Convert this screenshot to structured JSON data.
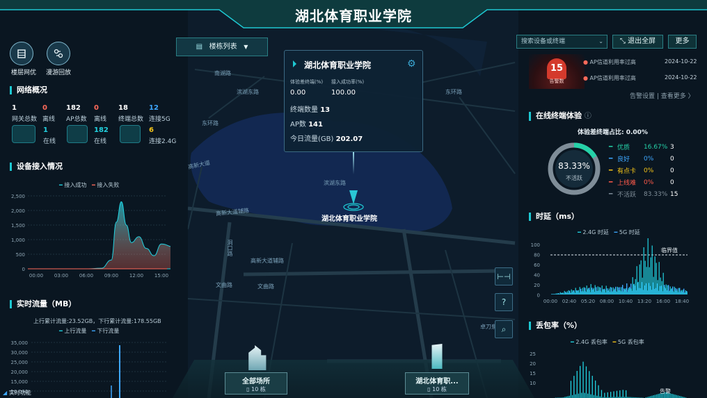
{
  "header": {
    "title": "湖北体育职业学院"
  },
  "left_tools": [
    {
      "label": "楼层网优",
      "icon": "building-floor-icon"
    },
    {
      "label": "漫游回放",
      "icon": "roaming-playback-icon"
    }
  ],
  "network": {
    "title": "网络概况",
    "row1": [
      {
        "value": "1",
        "label": "网关总数"
      },
      {
        "value": "0",
        "label": "离线"
      },
      {
        "value": "182",
        "label": "AP总数"
      },
      {
        "value": "0",
        "label": "离线"
      },
      {
        "value": "18",
        "label": "终端总数"
      },
      {
        "value": "12",
        "label": "连接5G"
      }
    ],
    "row2": [
      {
        "value": "1",
        "label": "在线"
      },
      {
        "value": "182",
        "label": "在线"
      },
      {
        "value": "6",
        "label": "连接2.4G"
      }
    ]
  },
  "access": {
    "title": "设备接入情况",
    "legend": [
      "接入成功",
      "接入失败"
    ],
    "yticks": [
      "2,500",
      "2,000",
      "1,500",
      "1,000",
      "500",
      "0"
    ],
    "xticks": [
      "00:00",
      "03:00",
      "06:00",
      "09:00",
      "12:00",
      "15:00"
    ]
  },
  "traffic": {
    "title": "实时流量（MB）",
    "summary": "上行累计流量:23.52GB，下行累计流量:178.55GB",
    "legend": [
      "上行流量",
      "下行流量"
    ],
    "yticks": [
      "35,000",
      "30,000",
      "25,000",
      "20,000",
      "15,000",
      "10,000"
    ],
    "bottom_label": "实时功能"
  },
  "building_list": {
    "label": "楼栋列表"
  },
  "popup": {
    "title": "湖北体育职业学院",
    "k1": "体验差终端(%)",
    "k2": "接入成功率(%)",
    "v1": "0.00",
    "v2": "100.00",
    "terminals_label": "终端数量",
    "terminals": "13",
    "ap_label": "AP数",
    "ap": "141",
    "flow_label": "今日流量(GB)",
    "flow": "202.07"
  },
  "marker": {
    "label": "湖北体育职业学院"
  },
  "map_labels": [
    "高新大道辅路",
    "高新大道辅路",
    "滨湖东路",
    "文曲路",
    "文曲路",
    "东环路",
    "东环路",
    "滨湖东路",
    "洞口路",
    "高新大道",
    "南湖路",
    "卓刀泉"
  ],
  "search": {
    "placeholder": "搜索设备或终端"
  },
  "actions": {
    "exit_full": "退出全屏",
    "more": "更多"
  },
  "alarm": {
    "count": "15",
    "count_label": "告警数",
    "items": [
      {
        "text": "AP信道利用率过高",
        "date": "2024-10-22"
      },
      {
        "text": "AP信道利用率过高",
        "date": "2024-10-22"
      }
    ],
    "links": "告警设置 | 查看更多 〉"
  },
  "experience": {
    "title": "在线终端体验",
    "bad_ratio": "体验差终端占比: 0.00%",
    "donut_pct": "83.33%",
    "donut_label": "不活跃",
    "donut_value": 0.8333,
    "rows": [
      {
        "name": "优质",
        "pct": "16.67%",
        "count": "3",
        "color": "#25d1a8"
      },
      {
        "name": "良好",
        "pct": "0%",
        "count": "0",
        "color": "#3ea7ff"
      },
      {
        "name": "有点卡",
        "pct": "0%",
        "count": "0",
        "color": "#f5c518"
      },
      {
        "name": "上线难",
        "pct": "0%",
        "count": "0",
        "color": "#ff5a4a"
      },
      {
        "name": "不活跃",
        "pct": "83.33%",
        "count": "15",
        "color": "#7f8d98"
      }
    ]
  },
  "latency": {
    "title": "时延（ms）",
    "legend": [
      "2.4G 时延",
      "5G 时延"
    ],
    "threshold_label": "临界值",
    "yticks": [
      "100",
      "80",
      "60",
      "40",
      "20",
      "0"
    ],
    "xticks": [
      "00:00",
      "02:40",
      "05:20",
      "08:00",
      "10:40",
      "13:20",
      "16:00",
      "18:40"
    ]
  },
  "loss": {
    "title": "丢包率（%）",
    "legend": [
      "2.4G 丢包率",
      "5G 丢包率"
    ],
    "yticks": [
      "25",
      "20",
      "15",
      "10"
    ],
    "corner": "告警"
  },
  "sites": [
    {
      "name": "全部场所",
      "count": "10 栋"
    },
    {
      "name": "湖北体育职...",
      "count": "10 栋"
    }
  ],
  "colors": {
    "accent": "#1ec8d2",
    "success": "#21d2e0",
    "fail": "#ff6a5a",
    "blue": "#3ea7ff"
  },
  "chart_data": [
    {
      "type": "area",
      "title": "设备接入情况",
      "categories": [
        "00:00",
        "03:00",
        "06:00",
        "09:00",
        "12:00",
        "15:00"
      ],
      "series": [
        {
          "name": "接入成功",
          "values": [
            0,
            0,
            0,
            2300,
            1000,
            850
          ]
        },
        {
          "name": "接入失败",
          "values": [
            0,
            0,
            0,
            0,
            0,
            0
          ]
        }
      ],
      "ylim": [
        0,
        2500
      ]
    },
    {
      "type": "line",
      "title": "时延（ms）",
      "categories": [
        "00:00",
        "02:40",
        "05:20",
        "08:00",
        "10:40",
        "13:20",
        "16:00",
        "18:40"
      ],
      "series": [
        {
          "name": "2.4G 时延",
          "values": [
            0,
            8,
            15,
            12,
            10,
            90,
            14,
            6
          ]
        },
        {
          "name": "5G 时延",
          "values": [
            0,
            6,
            12,
            10,
            18,
            20,
            15,
            8
          ]
        }
      ],
      "ylim": [
        0,
        100
      ]
    },
    {
      "type": "line",
      "title": "丢包率（%）",
      "series": [
        {
          "name": "2.4G 丢包率",
          "values": [
            0,
            2,
            22,
            3,
            5,
            1,
            24,
            2
          ]
        },
        {
          "name": "5G 丢包率",
          "values": [
            0,
            0,
            0,
            0,
            0,
            0,
            0,
            0
          ]
        }
      ],
      "ylim": [
        0,
        25
      ]
    }
  ]
}
